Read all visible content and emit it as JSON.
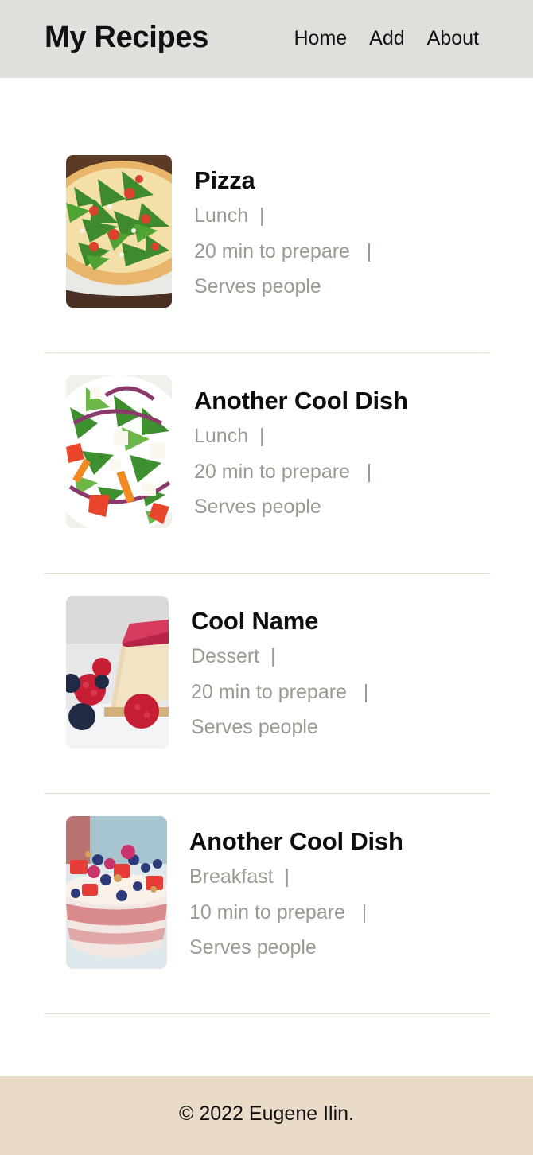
{
  "header": {
    "brand": "My Recipes",
    "nav": [
      "Home",
      "Add",
      "About"
    ]
  },
  "recipes": [
    {
      "title": "Pizza",
      "category": "Lunch",
      "prep": "20 min to prepare",
      "serves": "Serves people",
      "image": "pizza-photo"
    },
    {
      "title": "Another Cool Dish",
      "category": "Lunch",
      "prep": "20 min to prepare",
      "serves": "Serves people",
      "image": "salad-photo"
    },
    {
      "title": "Cool Name",
      "category": "Dessert",
      "prep": "20 min to prepare",
      "serves": "Serves people",
      "image": "cheesecake-photo"
    },
    {
      "title": "Another Cool Dish",
      "category": "Breakfast",
      "prep": "10 min to prepare",
      "serves": "Serves people",
      "image": "fruit-bowl-photo"
    }
  ],
  "separator": "|",
  "footer": {
    "copyright": "© 2022 Eugene Ilin."
  },
  "colors": {
    "header_bg": "#dfe0db",
    "footer_bg": "#eadbc8",
    "divider": "#eadbc8",
    "meta_text": "#9a9a91"
  }
}
